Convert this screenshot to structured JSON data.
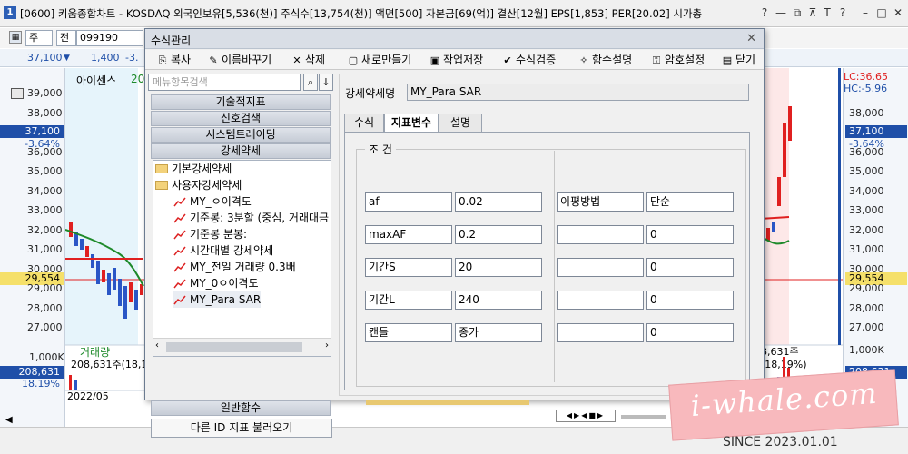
{
  "window": {
    "number": "1",
    "title": "[0600] 키움종합차트 - KOSDAQ 외국인보유[5,536(천)] 주식수[13,754(천)] 액면[500] 자본금[69(억)] 결산[12월] EPS[1,853] PER[20.02] 시가총"
  },
  "top_controls": {
    "mode": "주",
    "period": "전",
    "code": "099190"
  },
  "info_bar": {
    "price": "37,100",
    "arrow": "▼",
    "change": "1,400",
    "rate": "-3."
  },
  "chart_left": {
    "legend_label": "아이센스",
    "legend_value": "20",
    "price_ticks": [
      "39,000",
      "38,000",
      "37,100",
      "-3.64%",
      "36,000",
      "35,000",
      "34,000",
      "33,000",
      "32,000",
      "31,000",
      "30,000",
      "29,554",
      "29,000",
      "28,000",
      "27,000"
    ],
    "volume_tick": "1,000K",
    "volume_value": "208,631",
    "volume_rate": "18.19%",
    "volume_label": "거래량",
    "volume_text": "208,631주(18,19",
    "date_label": "2022/05"
  },
  "chart_right": {
    "lc": "LC:36.65",
    "hc": "HC:-5.96",
    "price_ticks": [
      "38,000",
      "37,100",
      "-3.64%",
      "36,000",
      "35,000",
      "34,000",
      "33,000",
      "32,000",
      "31,000",
      "30,000",
      "29,554",
      "29,000",
      "28,000",
      "27,000"
    ],
    "volume_text": "8,631주(18,19%)",
    "volume_tick": "1,000K",
    "volume_value": "208,631",
    "volume_rate": "18.19%"
  },
  "dialog": {
    "title": "수식관리",
    "toolbar": [
      {
        "label": "복사",
        "icon": "copy-icon"
      },
      {
        "label": "이름바꾸기",
        "icon": "rename-icon"
      },
      {
        "label": "삭제",
        "icon": "delete-icon"
      },
      {
        "label": "새로만들기",
        "icon": "new-icon"
      },
      {
        "label": "작업저장",
        "icon": "save-icon"
      },
      {
        "label": "수식검증",
        "icon": "check-icon"
      },
      {
        "label": "함수설명",
        "icon": "wand-icon"
      },
      {
        "label": "암호설정",
        "icon": "key-icon"
      },
      {
        "label": "닫기",
        "icon": "close-doc-icon"
      }
    ],
    "search_placeholder": "메뉴항목검색",
    "categories": [
      "기술적지표",
      "신호검색",
      "시스템트레이딩",
      "강세약세"
    ],
    "tree": [
      {
        "label": "기본강세약세",
        "type": "folder"
      },
      {
        "label": "사용자강세약세",
        "type": "folder"
      },
      {
        "label": "MY_ㅇ이격도",
        "type": "item"
      },
      {
        "label": "기준봉: 3분할 (중심, 거래대금",
        "type": "item"
      },
      {
        "label": "기준봉 분봉:",
        "type": "item"
      },
      {
        "label": "시간대별 강세약세",
        "type": "item"
      },
      {
        "label": "MY_전일 거래량 0.3배",
        "type": "item"
      },
      {
        "label": "MY_0ㅇ이격도",
        "type": "item"
      },
      {
        "label": "MY_Para SAR",
        "type": "item"
      }
    ],
    "general_category": "일반함수",
    "other_id_button": "다른 ID 지표 불러오기",
    "name_label": "강세약세명",
    "name_value": "MY_Para SAR",
    "tabs": [
      "수식",
      "지표변수",
      "설명"
    ],
    "active_tab": "지표변수",
    "condition_label": "조 건",
    "params_left": [
      {
        "name": "af",
        "value": "0.02"
      },
      {
        "name": "maxAF",
        "value": "0.2"
      },
      {
        "name": "기간S",
        "value": "20"
      },
      {
        "name": "기간L",
        "value": "240"
      },
      {
        "name": "캔들",
        "value": "종가"
      }
    ],
    "params_right": [
      {
        "name": "이평방법",
        "value": "단순"
      },
      {
        "name": "",
        "value": "0"
      },
      {
        "name": "",
        "value": "0"
      },
      {
        "name": "",
        "value": "0"
      },
      {
        "name": "",
        "value": "0"
      }
    ]
  },
  "watermark": {
    "text": "i-whale.com",
    "since": "SINCE 2023.01.01"
  },
  "colors": {
    "accent_blue": "#1f4fa8",
    "up_red": "#e02020",
    "down_blue": "#2a56c6",
    "ma_green": "#1e8a2a",
    "watermark_pink": "#f8b9bd"
  }
}
